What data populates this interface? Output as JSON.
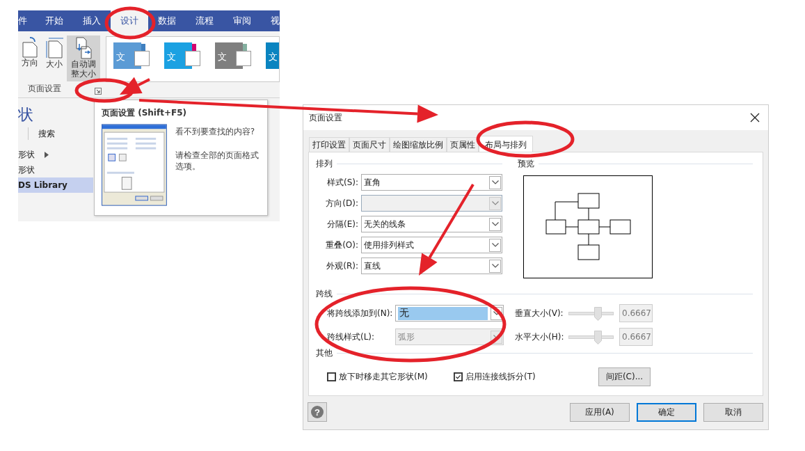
{
  "ribbon": {
    "tabs": [
      {
        "label": "件",
        "selected": false
      },
      {
        "label": "开始",
        "selected": false
      },
      {
        "label": "插入",
        "selected": false
      },
      {
        "label": "设计",
        "selected": true
      },
      {
        "label": "数据",
        "selected": false
      },
      {
        "label": "流程",
        "selected": false
      },
      {
        "label": "审阅",
        "selected": false
      },
      {
        "label": "视",
        "selected": false
      }
    ],
    "buttons": [
      {
        "kind": "orientation",
        "label": "方向",
        "selected": false
      },
      {
        "kind": "size",
        "label": "大小",
        "selected": false
      },
      {
        "kind": "autofit",
        "label": "自动调整大小",
        "selected": true
      }
    ],
    "group_label": "页面设置",
    "themes": [
      {
        "label": "文",
        "color": "#5b9bd5"
      },
      {
        "label": "文",
        "color": "#1ba1e2"
      },
      {
        "label": "文",
        "color": "#7f7f7f"
      },
      {
        "label": "文",
        "color": "#0a84c0"
      }
    ]
  },
  "shapes_pane": {
    "title": "状",
    "search_label": "搜索",
    "items": [
      {
        "label": "形状",
        "expandable": true,
        "selected": false
      },
      {
        "label": "形状",
        "expandable": false,
        "selected": false
      },
      {
        "label": "DS Library",
        "expandable": false,
        "selected": true
      }
    ]
  },
  "tooltip": {
    "title": "页面设置 (Shift+F5)",
    "lines": [
      "看不到要查找的内容?",
      "请检查全部的页面格式选项。"
    ]
  },
  "dialog": {
    "title": "页面设置",
    "tabs": [
      {
        "label": "打印设置",
        "selected": false
      },
      {
        "label": "页面尺寸",
        "selected": false
      },
      {
        "label": "绘图缩放比例",
        "selected": false
      },
      {
        "label": "页属性",
        "selected": false
      },
      {
        "label": "布局与排列",
        "selected": true
      }
    ],
    "arrangement": {
      "title": "排列",
      "fields": [
        {
          "label": "样式(S):",
          "value": "直角",
          "disabled": false
        },
        {
          "label": "方向(D):",
          "disabled": true
        },
        {
          "label": "分隔(E):",
          "value": "无关的线条",
          "disabled": false
        },
        {
          "label": "重叠(O):",
          "value": "使用排列样式",
          "disabled": false
        },
        {
          "label": "外观(R):",
          "value": "直线",
          "disabled": false
        }
      ]
    },
    "preview": {
      "title": "预览"
    },
    "line_jumps": {
      "title": "跨线",
      "add_to": {
        "label": "将跨线添加到(N):",
        "value": "无",
        "highlighted": true,
        "disabled": false
      },
      "style": {
        "label": "跨线样式(L):",
        "value": "弧形",
        "disabled": true
      },
      "sizes": [
        {
          "label": "垂直大小(V):",
          "level": 0.65,
          "value": "0.6667"
        },
        {
          "label": "水平大小(H):",
          "level": 0.65,
          "value": "0.6667"
        }
      ]
    },
    "other": {
      "title": "其他",
      "checkboxes": [
        {
          "label": "放下时移走其它形状(M)",
          "checked": false
        },
        {
          "label": "启用连接线拆分(T)",
          "checked": true
        }
      ],
      "spacing_button": "间距(C)..."
    },
    "help_label": "?",
    "buttons": [
      {
        "label": "应用(A)",
        "default": false
      },
      {
        "label": "确定",
        "default": true
      },
      {
        "label": "取消",
        "default": false
      }
    ]
  }
}
